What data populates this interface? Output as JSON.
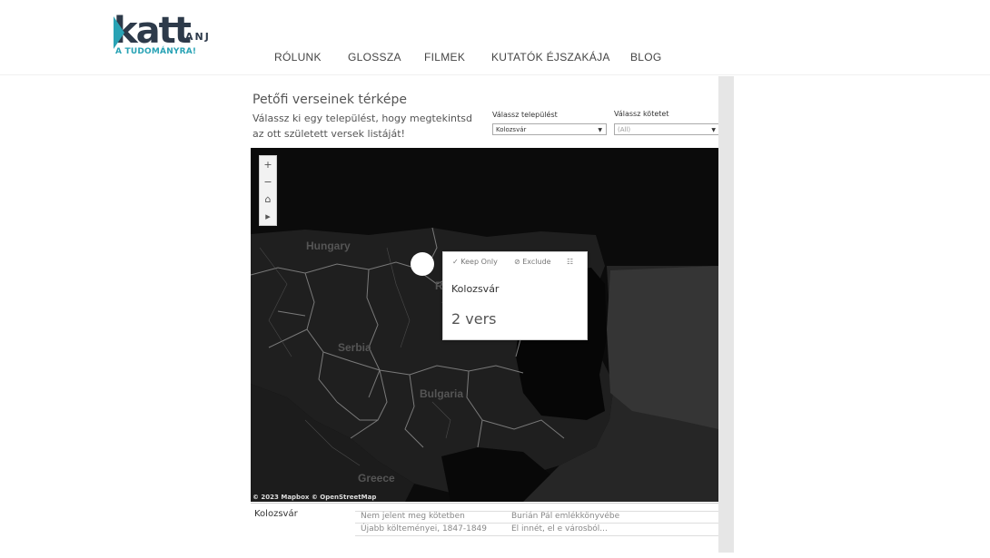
{
  "header": {
    "logo": {
      "main": "katt",
      "anj": "ANJ",
      "sub": "A TUDOMÁNYRA!"
    },
    "nav": [
      "RÓLUNK",
      "GLOSSZA",
      "FILMEK",
      "KUTATÓK ÉJSZAKÁJA",
      "BLOG"
    ]
  },
  "viz": {
    "title": "Petőfi verseinek térképe",
    "subtitle": "Válassz ki egy települést, hogy megtekintsd az ott született versek listáját!",
    "filter_settlement": {
      "label": "Válassz települést",
      "value": "Kolozsvár"
    },
    "filter_volume": {
      "label": "Válassz kötetet",
      "value": "(All)"
    },
    "map": {
      "controls": [
        "+",
        "−",
        "⌂",
        "▸"
      ],
      "labels": [
        "Hungary",
        "Serbia",
        "Bulgaria",
        "Greece",
        "R"
      ],
      "attribution": "© 2023 Mapbox  © OpenStreetMap"
    },
    "tooltip": {
      "keep_only": "Keep Only",
      "exclude": "Exclude",
      "place": "Kolozsvár",
      "count": "2 vers"
    },
    "table": {
      "place": "Kolozsvár",
      "rows": [
        {
          "volume": "Nem jelent meg kötetben",
          "poem": "Burián Pál emlékkönyvébe"
        },
        {
          "volume": "Újabb költeményei, 1847-1849",
          "poem": "El innét, el e városból..."
        }
      ]
    }
  }
}
